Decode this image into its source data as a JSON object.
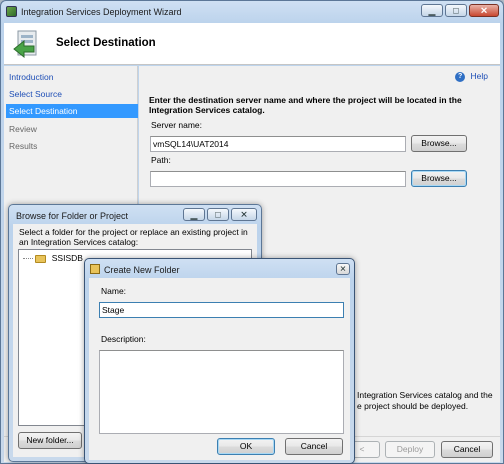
{
  "main": {
    "title": "Integration Services Deployment Wizard",
    "header_title": "Select Destination",
    "nav": [
      "Introduction",
      "Select Source",
      "Select Destination",
      "Review",
      "Results"
    ],
    "help_label": "Help",
    "instruction": "Enter the destination server name and where the project will be located in the Integration Services catalog.",
    "server_label": "Server name:",
    "server_value": "vmSQL14\\UAT2014",
    "browse_label": "Browse...",
    "path_label": "Path:",
    "path_value": "",
    "partial_text_1": "Integration Services catalog and the",
    "partial_text_2": "e project should be deployed.",
    "back_label": "<",
    "deploy_label": "Deploy",
    "cancel_label": "Cancel"
  },
  "browse_dialog": {
    "title": "Browse for Folder or Project",
    "instruction": "Select a folder for the project or replace an existing project in an Integration Services catalog:",
    "tree_root": "SSISDB",
    "new_folder_label": "New folder..."
  },
  "new_folder_dialog": {
    "title": "Create New Folder",
    "name_label": "Name:",
    "name_value": "Stage",
    "description_label": "Description:",
    "description_value": "",
    "ok_label": "OK",
    "cancel_label": "Cancel"
  },
  "colors": {
    "nav_selected_bg": "#3399ff",
    "link_blue": "#1f4fb6",
    "accent_blue": "#3c7fb1"
  }
}
